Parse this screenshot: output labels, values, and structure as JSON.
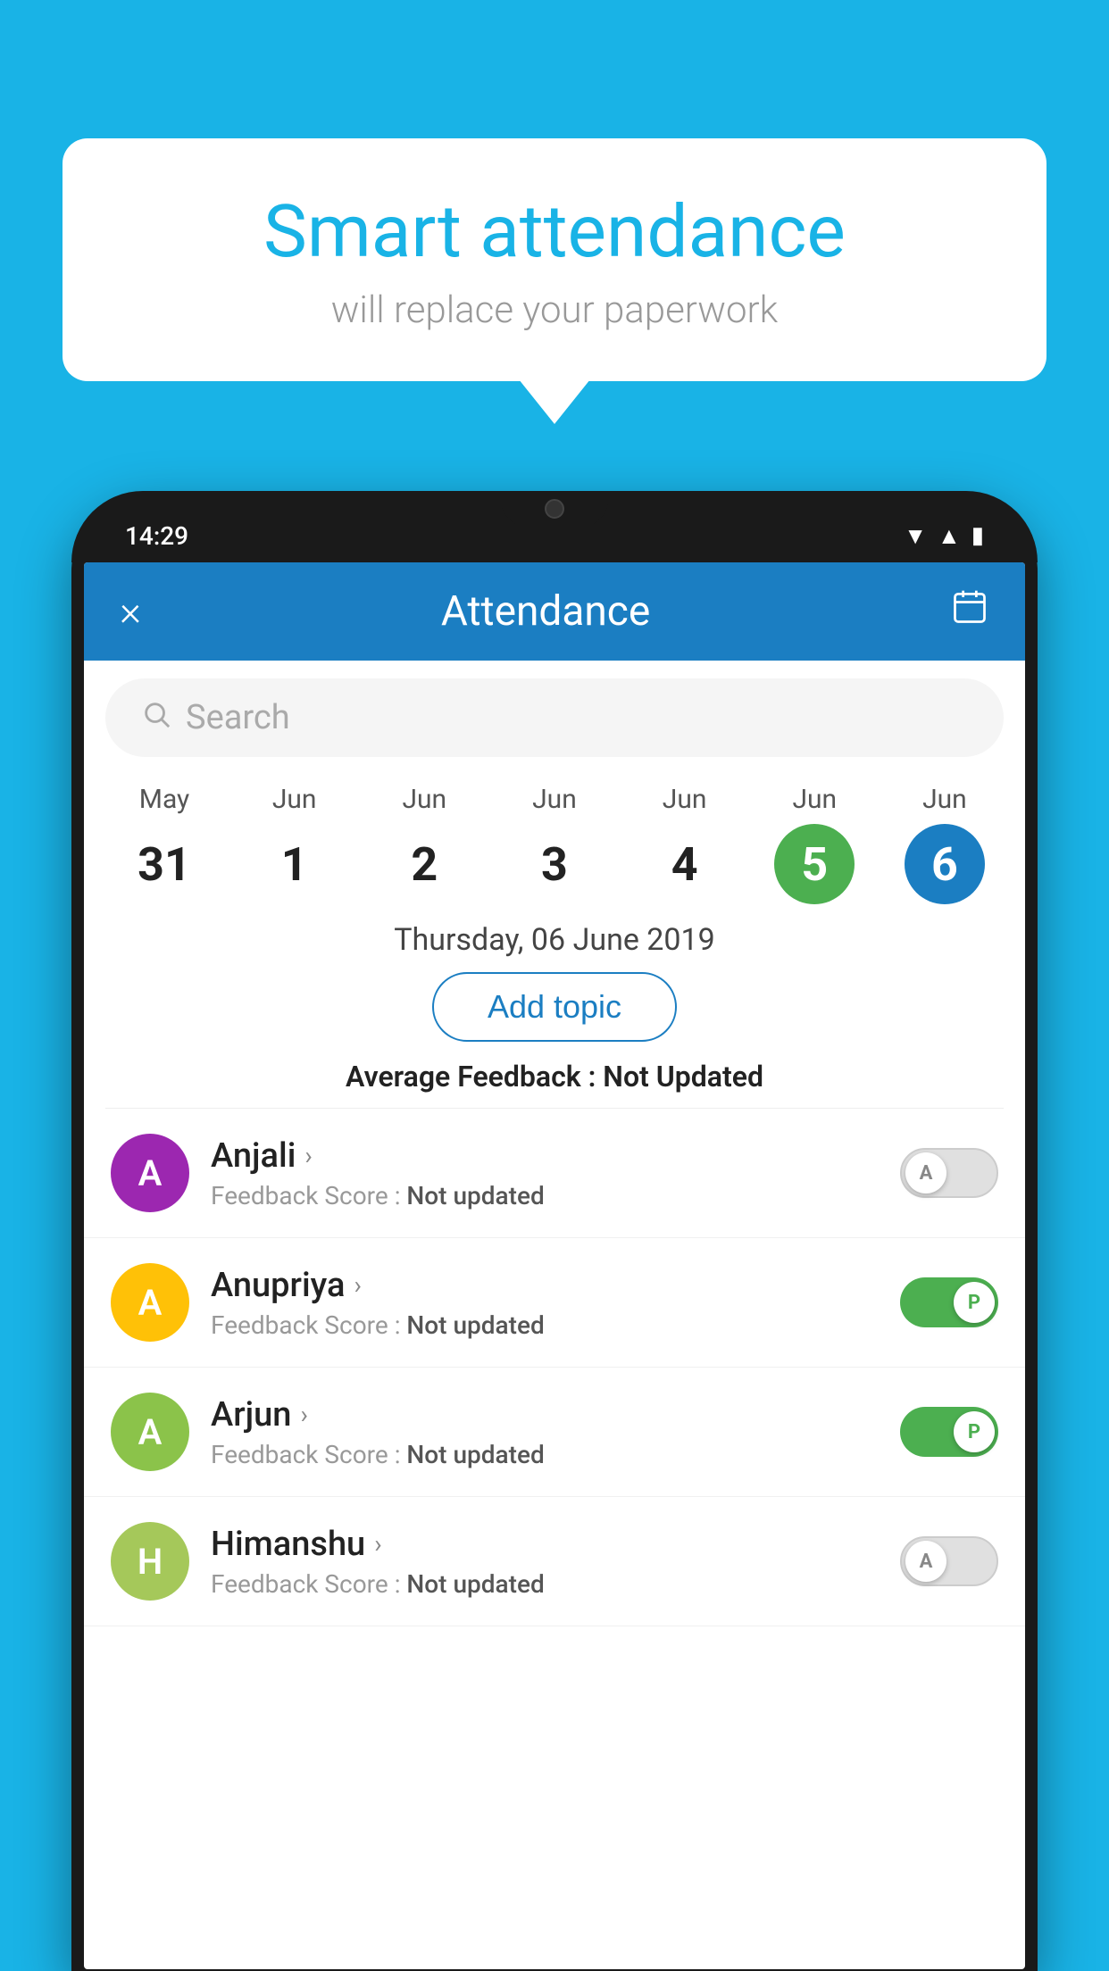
{
  "background_color": "#19B3E6",
  "bubble": {
    "title": "Smart attendance",
    "subtitle": "will replace your paperwork"
  },
  "phone": {
    "status_bar": {
      "time": "14:29",
      "icons": [
        "wifi",
        "signal",
        "battery"
      ]
    },
    "header": {
      "close_label": "×",
      "title": "Attendance",
      "calendar_icon": "📅"
    },
    "search": {
      "placeholder": "Search"
    },
    "calendar": {
      "days": [
        {
          "month": "May",
          "date": "31",
          "state": "normal"
        },
        {
          "month": "Jun",
          "date": "1",
          "state": "normal"
        },
        {
          "month": "Jun",
          "date": "2",
          "state": "normal"
        },
        {
          "month": "Jun",
          "date": "3",
          "state": "normal"
        },
        {
          "month": "Jun",
          "date": "4",
          "state": "normal"
        },
        {
          "month": "Jun",
          "date": "5",
          "state": "today"
        },
        {
          "month": "Jun",
          "date": "6",
          "state": "selected"
        }
      ]
    },
    "selected_date_label": "Thursday, 06 June 2019",
    "add_topic_label": "Add topic",
    "average_feedback_label": "Average Feedback :",
    "average_feedback_value": "Not Updated",
    "students": [
      {
        "name": "Anjali",
        "avatar_letter": "A",
        "avatar_color": "#9C27B0",
        "feedback_label": "Feedback Score :",
        "feedback_value": "Not updated",
        "toggle_state": "off",
        "toggle_label": "A"
      },
      {
        "name": "Anupriya",
        "avatar_letter": "A",
        "avatar_color": "#FFC107",
        "feedback_label": "Feedback Score :",
        "feedback_value": "Not updated",
        "toggle_state": "on",
        "toggle_label": "P"
      },
      {
        "name": "Arjun",
        "avatar_letter": "A",
        "avatar_color": "#8BC34A",
        "feedback_label": "Feedback Score :",
        "feedback_value": "Not updated",
        "toggle_state": "on",
        "toggle_label": "P"
      },
      {
        "name": "Himanshu",
        "avatar_letter": "H",
        "avatar_color": "#A5C85A",
        "feedback_label": "Feedback Score :",
        "feedback_value": "Not updated",
        "toggle_state": "off",
        "toggle_label": "A"
      }
    ]
  }
}
